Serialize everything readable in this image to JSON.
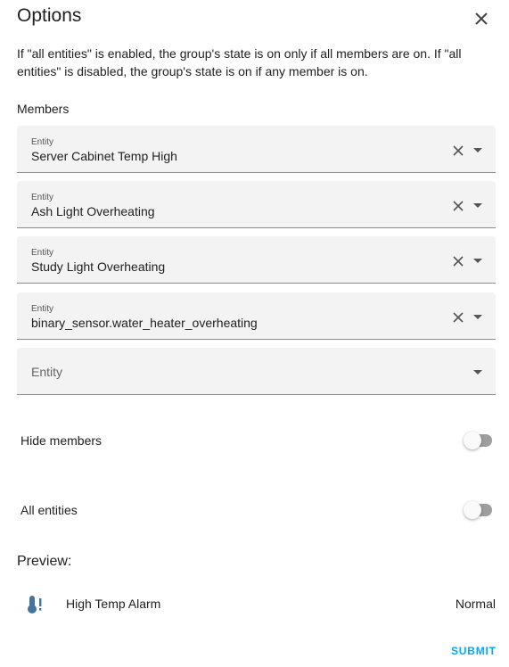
{
  "dialog": {
    "title": "Options",
    "description": "If \"all entities\" is enabled, the group's state is on only if all members are on. If \"all entities\" is disabled, the group's state is on if any member is on."
  },
  "members": {
    "label": "Members",
    "fields": [
      {
        "label": "Entity",
        "value": "Server Cabinet Temp High"
      },
      {
        "label": "Entity",
        "value": "Ash Light Overheating"
      },
      {
        "label": "Entity",
        "value": "Study Light Overheating"
      },
      {
        "label": "Entity",
        "value": "binary_sensor.water_heater_overheating"
      }
    ],
    "empty_field_placeholder": "Entity"
  },
  "toggles": {
    "hide_members": {
      "label": "Hide members",
      "checked": false
    },
    "all_entities": {
      "label": "All entities",
      "checked": false
    }
  },
  "preview": {
    "label": "Preview:",
    "icon": "thermometer-alert-icon",
    "icon_color": "#44739e",
    "entity_name": "High Temp Alarm",
    "state": "Normal"
  },
  "actions": {
    "submit_label": "SUBMIT",
    "submit_color": "#03a9f4"
  }
}
